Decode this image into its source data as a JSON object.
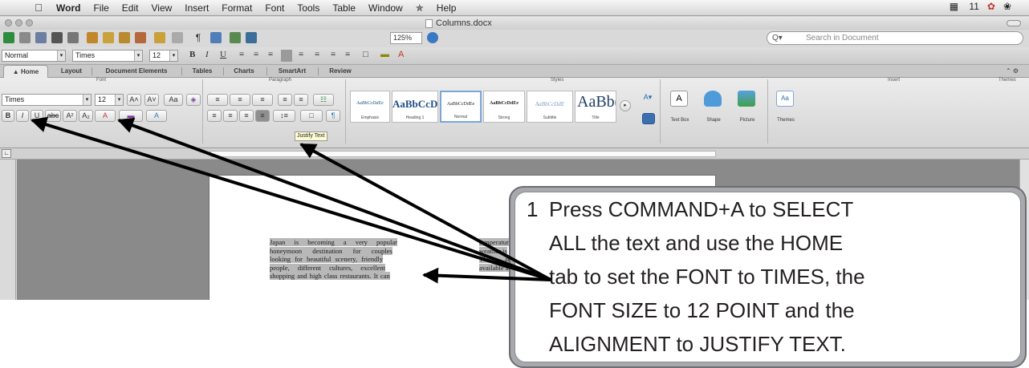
{
  "menubar": {
    "app_name": "Word",
    "items": [
      "File",
      "Edit",
      "View",
      "Insert",
      "Format",
      "Font",
      "Tools",
      "Table",
      "Window",
      "Help"
    ],
    "status": "11"
  },
  "window": {
    "title": "Columns.docx"
  },
  "toolbar": {
    "zoom": "125%",
    "search_placeholder": "Search in Document"
  },
  "formatting": {
    "style": "Normal",
    "font": "Times",
    "size": "12"
  },
  "ribbon": {
    "tabs": [
      "Home",
      "Layout",
      "Document Elements",
      "Tables",
      "Charts",
      "SmartArt",
      "Review"
    ],
    "groups": {
      "font": "Font",
      "paragraph": "Paragraph",
      "styles": "Styles",
      "insert": "Insert",
      "themes": "Themes"
    },
    "font_name": "Times",
    "font_size": "12",
    "styles": [
      {
        "sample": "AaBbCcDdEe",
        "name": "Emphasis"
      },
      {
        "sample": "AaBbCcD",
        "name": "Heading 1"
      },
      {
        "sample": "AaBbCcDdEe",
        "name": "Normal"
      },
      {
        "sample": "AaBbCcDdEe",
        "name": "Strong"
      },
      {
        "sample": "AaBbCcDdE",
        "name": "Subtitle"
      },
      {
        "sample": "AaBb(",
        "name": "Title"
      }
    ],
    "insert": [
      "Text Box",
      "Shape",
      "Picture"
    ],
    "themes_label": "Themes"
  },
  "tooltip": "Justify Text",
  "document": {
    "col1": [
      "Japan is becoming a very popular",
      "honeymoon destination for couples",
      "looking for beautiful scenery, friendly",
      "people, different cultures, excellent",
      "shopping and high class restaurants. It can"
    ],
    "col2": [
      "temperature is",
      "weather is",
      "",
      "There are",
      "available and we"
    ]
  },
  "callout": {
    "number": "1",
    "lines": [
      "Press COMMAND+A to SELECT",
      "ALL the text and use the HOME",
      "tab to set the FONT to TIMES, the",
      "FONT SIZE to 12 POINT and the",
      "ALIGNMENT to JUSTIFY TEXT."
    ]
  },
  "colors": {
    "callout_border": "#6d6e71",
    "callout_frame": "#a7a9ac",
    "arrow": "#000000",
    "selection": "#b8b8b8"
  }
}
